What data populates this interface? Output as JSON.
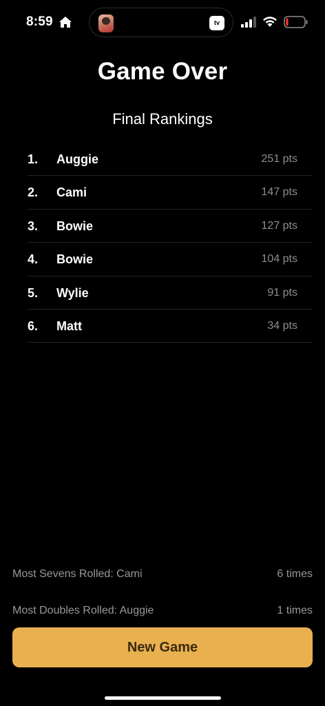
{
  "status_bar": {
    "time": "8:59",
    "appletv_label": "tv"
  },
  "title": "Game Over",
  "section_title": "Final Rankings",
  "rankings": [
    {
      "rank": "1.",
      "name": "Auggie",
      "points": "251 pts"
    },
    {
      "rank": "2.",
      "name": "Cami",
      "points": "147 pts"
    },
    {
      "rank": "3.",
      "name": "Bowie",
      "points": "127 pts"
    },
    {
      "rank": "4.",
      "name": "Bowie",
      "points": "104 pts"
    },
    {
      "rank": "5.",
      "name": "Wylie",
      "points": "91 pts"
    },
    {
      "rank": "6.",
      "name": "Matt",
      "points": "34 pts"
    }
  ],
  "stats": [
    {
      "label": "Most Sevens Rolled: Cami",
      "value": "6 times"
    },
    {
      "label": "Most Doubles Rolled: Auggie",
      "value": "1 times"
    }
  ],
  "button_label": "New Game",
  "colors": {
    "background": "#000000",
    "accent": "#e8b04f",
    "secondary_text": "#8e8e93",
    "divider": "#242426"
  }
}
